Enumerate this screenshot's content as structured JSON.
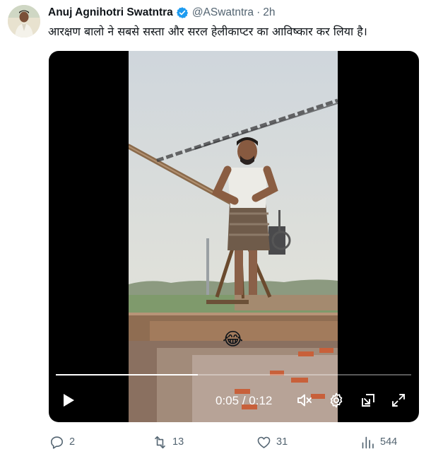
{
  "tweet": {
    "author_name": "Anuj Agnihotri Swatntra",
    "verified_icon": "verified-badge-icon",
    "handle": "@ASwatntra",
    "separator": "·",
    "time": "2h",
    "text": "आरक्षण बालो ने सबसे सस्ता और सरल हेलीकाप्टर का आविष्कार कर लिया है।"
  },
  "video": {
    "emoji": "😂",
    "current_time": "0:05",
    "duration": "0:12",
    "time_separator": " / ",
    "progress_fraction": 0.4,
    "icons": [
      "play-icon",
      "mute-icon",
      "settings-icon",
      "picture-in-picture-icon",
      "fullscreen-icon"
    ]
  },
  "actions": {
    "replies": "2",
    "reposts": "13",
    "likes": "31",
    "views": "544"
  },
  "colors": {
    "verified": "#1d9bf0",
    "secondary_text": "#536471",
    "primary_text": "#0f1419"
  }
}
